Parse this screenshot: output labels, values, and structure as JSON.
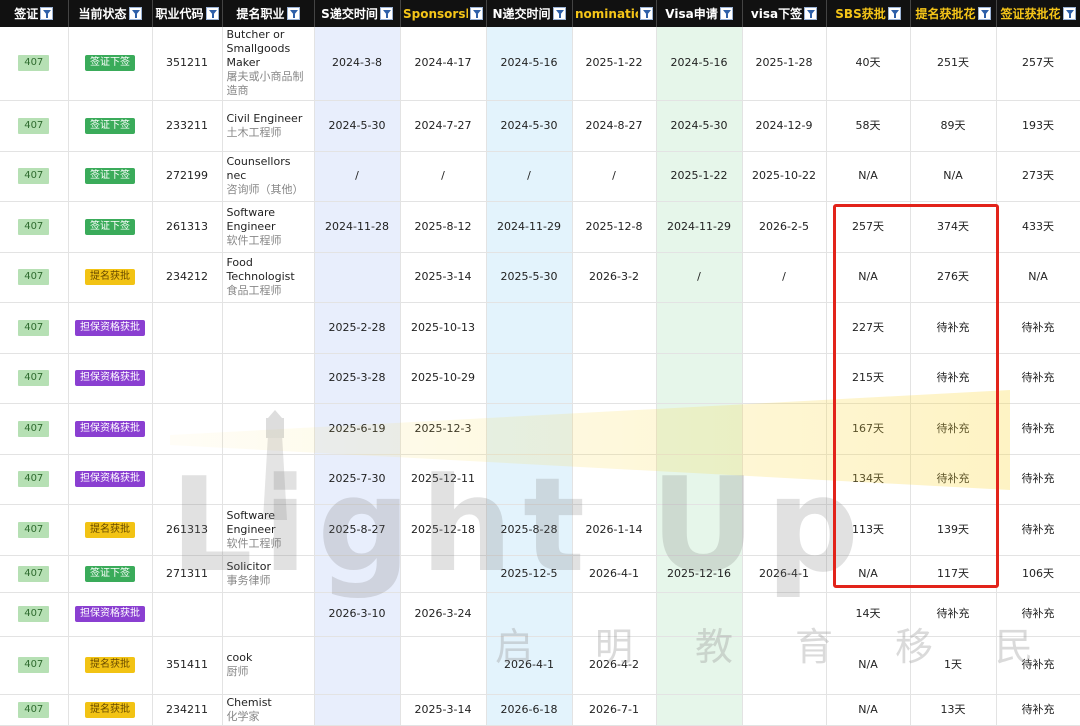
{
  "headers": [
    "签证",
    "当前状态",
    "职业代码",
    "提名职业",
    "S递交时间",
    "Sponsorsh",
    "N递交时间",
    "nominatio",
    "Visa申请",
    "visa下签",
    "SBS获批",
    "提名获批花",
    "签证获批花"
  ],
  "rows": [
    {
      "visa": "407",
      "status": "签证下签",
      "status_color": "green",
      "code": "351211",
      "job_en": "Butcher or Smallgoods Maker",
      "job_zh": "屠夫或小商品制造商",
      "s_submit": "2024-3-8",
      "sponsorship": "2024-4-17",
      "n_submit": "2024-5-16",
      "nomination": "2025-1-22",
      "visa_apply": "2024-5-16",
      "visa_grant": "2025-1-28",
      "sbs": "40天",
      "nom_days": "251天",
      "visa_days": "257天"
    },
    {
      "visa": "407",
      "status": "签证下签",
      "status_color": "green",
      "code": "233211",
      "job_en": "Civil Engineer",
      "job_zh": "土木工程师",
      "s_submit": "2024-5-30",
      "sponsorship": "2024-7-27",
      "n_submit": "2024-5-30",
      "nomination": "2024-8-27",
      "visa_apply": "2024-5-30",
      "visa_grant": "2024-12-9",
      "sbs": "58天",
      "nom_days": "89天",
      "visa_days": "193天"
    },
    {
      "visa": "407",
      "status": "签证下签",
      "status_color": "green",
      "code": "272199",
      "job_en": "Counsellors nec",
      "job_zh": "咨询师（其他）",
      "s_submit": "/",
      "sponsorship": "/",
      "n_submit": "/",
      "nomination": "/",
      "visa_apply": "2025-1-22",
      "visa_grant": "2025-10-22",
      "sbs": "N/A",
      "nom_days": "N/A",
      "visa_days": "273天"
    },
    {
      "visa": "407",
      "status": "签证下签",
      "status_color": "green",
      "code": "261313",
      "job_en": "Software Engineer",
      "job_zh": "软件工程师",
      "s_submit": "2024-11-28",
      "sponsorship": "2025-8-12",
      "n_submit": "2024-11-29",
      "nomination": "2025-12-8",
      "visa_apply": "2024-11-29",
      "visa_grant": "2026-2-5",
      "sbs": "257天",
      "nom_days": "374天",
      "visa_days": "433天"
    },
    {
      "visa": "407",
      "status": "提名获批",
      "status_color": "yellow",
      "code": "234212",
      "job_en": "Food Technologist",
      "job_zh": "食品工程师",
      "s_submit": "",
      "sponsorship": "2025-3-14",
      "n_submit": "2025-5-30",
      "nomination": "2026-3-2",
      "visa_apply": "/",
      "visa_grant": "/",
      "sbs": "N/A",
      "nom_days": "276天",
      "visa_days": "N/A"
    },
    {
      "visa": "407",
      "status": "担保资格获批",
      "status_color": "purple",
      "code": "",
      "job_en": "",
      "job_zh": "",
      "s_submit": "2025-2-28",
      "sponsorship": "2025-10-13",
      "n_submit": "",
      "nomination": "",
      "visa_apply": "",
      "visa_grant": "",
      "sbs": "227天",
      "nom_days": "待补充",
      "visa_days": "待补充"
    },
    {
      "visa": "407",
      "status": "担保资格获批",
      "status_color": "purple",
      "code": "",
      "job_en": "",
      "job_zh": "",
      "s_submit": "2025-3-28",
      "sponsorship": "2025-10-29",
      "n_submit": "",
      "nomination": "",
      "visa_apply": "",
      "visa_grant": "",
      "sbs": "215天",
      "nom_days": "待补充",
      "visa_days": "待补充"
    },
    {
      "visa": "407",
      "status": "担保资格获批",
      "status_color": "purple",
      "code": "",
      "job_en": "",
      "job_zh": "",
      "s_submit": "2025-6-19",
      "sponsorship": "2025-12-3",
      "n_submit": "",
      "nomination": "",
      "visa_apply": "",
      "visa_grant": "",
      "sbs": "167天",
      "nom_days": "待补充",
      "visa_days": "待补充"
    },
    {
      "visa": "407",
      "status": "担保资格获批",
      "status_color": "purple",
      "code": "",
      "job_en": "",
      "job_zh": "",
      "s_submit": "2025-7-30",
      "sponsorship": "2025-12-11",
      "n_submit": "",
      "nomination": "",
      "visa_apply": "",
      "visa_grant": "",
      "sbs": "134天",
      "nom_days": "待补充",
      "visa_days": "待补充"
    },
    {
      "visa": "407",
      "status": "提名获批",
      "status_color": "yellow",
      "code": "261313",
      "job_en": "Software Engineer",
      "job_zh": "软件工程师",
      "s_submit": "2025-8-27",
      "sponsorship": "2025-12-18",
      "n_submit": "2025-8-28",
      "nomination": "2026-1-14",
      "visa_apply": "",
      "visa_grant": "",
      "sbs": "113天",
      "nom_days": "139天",
      "visa_days": "待补充"
    },
    {
      "visa": "407",
      "status": "签证下签",
      "status_color": "green",
      "code": "271311",
      "job_en": "Solicitor",
      "job_zh": "事务律师",
      "s_submit": "",
      "sponsorship": "",
      "n_submit": "2025-12-5",
      "nomination": "2026-4-1",
      "visa_apply": "2025-12-16",
      "visa_grant": "2026-4-1",
      "sbs": "N/A",
      "nom_days": "117天",
      "visa_days": "106天"
    },
    {
      "visa": "407",
      "status": "担保资格获批",
      "status_color": "purple",
      "code": "",
      "job_en": "",
      "job_zh": "",
      "s_submit": "2026-3-10",
      "sponsorship": "2026-3-24",
      "n_submit": "",
      "nomination": "",
      "visa_apply": "",
      "visa_grant": "",
      "sbs": "14天",
      "nom_days": "待补充",
      "visa_days": "待补充"
    },
    {
      "visa": "407",
      "status": "提名获批",
      "status_color": "yellow",
      "code": "351411",
      "job_en": "cook",
      "job_zh": "厨师",
      "s_submit": "",
      "sponsorship": "",
      "n_submit": "2026-4-1",
      "nomination": "2026-4-2",
      "visa_apply": "",
      "visa_grant": "",
      "sbs": "N/A",
      "nom_days": "1天",
      "visa_days": "待补充"
    },
    {
      "visa": "407",
      "status": "提名获批",
      "status_color": "yellow",
      "code": "234211",
      "job_en": "Chemist",
      "job_zh": "化学家",
      "s_submit": "",
      "sponsorship": "2025-3-14",
      "n_submit": "2026-6-18",
      "nomination": "2026-7-1",
      "visa_apply": "",
      "visa_grant": "",
      "sbs": "N/A",
      "nom_days": "13天",
      "visa_days": "待补充"
    }
  ],
  "watermark": {
    "brand": "Light Up",
    "brand_cn": "启明教育移民"
  },
  "colors": {
    "status_green": "#3aab5a",
    "status_yellow": "#f2c314",
    "status_purple": "#8a3fd1",
    "highlight_red": "#e2231a"
  }
}
